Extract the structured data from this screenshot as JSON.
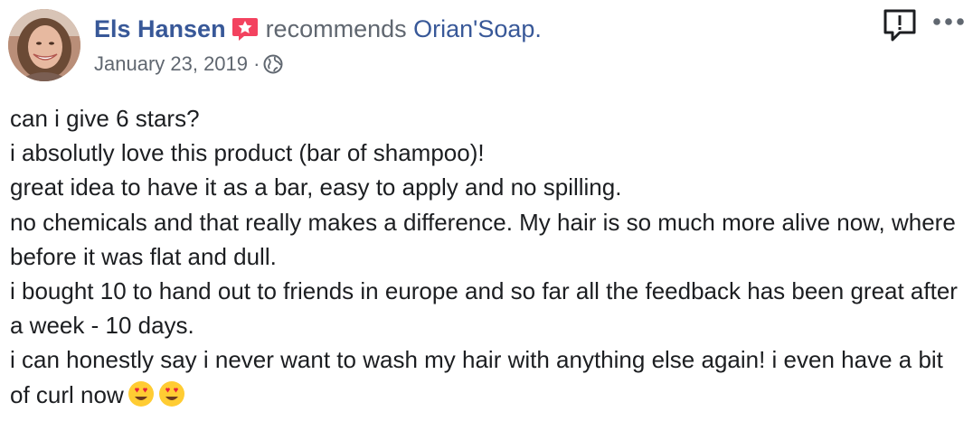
{
  "post": {
    "author_name": "Els Hansen",
    "action_text": "recommends",
    "page_name": "Orian'Soap.",
    "date": "January 23, 2019",
    "meta_separator": "·",
    "icons": {
      "recommend": "recommend-star-icon",
      "privacy": "globe-icon",
      "report": "report-exclamation-icon",
      "more": "more-options-icon",
      "emoji": "heart-eyes-emoji"
    },
    "colors": {
      "link": "#385898",
      "secondary_text": "#606770",
      "body_text": "#1c1e21",
      "recommend_accent": "#f3425f"
    },
    "body_lines": [
      "can i give 6 stars?",
      "i absolutly love this product (bar of shampoo)!",
      "great idea to have it as a bar, easy to apply and no spilling.",
      "no chemicals and that really makes a difference. My hair is so much more alive now, where before it was flat and dull.",
      "i bought 10 to hand out to friends in europe and so far all the feedback has been great after a week - 10 days.",
      "i can honestly say i never want to wash my hair with anything else again! i even have a bit of curl now"
    ]
  }
}
